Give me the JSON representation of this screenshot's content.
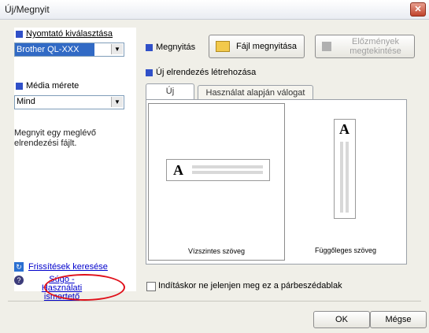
{
  "window": {
    "title": "Új/Megnyit",
    "close_label": "✕"
  },
  "left": {
    "printer_label": "Nyomtató kiválasztása",
    "printer_value": "Brother QL-XXX",
    "media_label": "Média mérete",
    "media_value": "Mind",
    "description": "Megnyit egy meglévő elrendezési fájlt.",
    "updates_link": "Frissítések keresése",
    "help_link": "Súgó - Használati ismertető"
  },
  "top": {
    "open_label": "Megnyitás",
    "open_file_button": "Fájl megnyitása",
    "history_button": "Előzmények megtekintése",
    "new_layout_label": "Új elrendezés létrehozása"
  },
  "tabs": [
    {
      "label": "Új",
      "active": true
    },
    {
      "label": "Használat alapján válogat",
      "active": false
    }
  ],
  "cards": [
    {
      "label": "Vízszintes szöveg",
      "glyph": "A"
    },
    {
      "label": "Függőleges szöveg",
      "glyph": "A"
    }
  ],
  "footer": {
    "startup_checkbox": "Indításkor ne jelenjen meg ez a párbeszédablak",
    "ok": "OK",
    "cancel": "Mégse"
  },
  "colors": {
    "accent_square": "#3050c8",
    "highlight": "#316ac5",
    "annotation_circle": "#e0101a"
  },
  "icons": [
    "close-icon",
    "folder-open-icon",
    "history-icon",
    "update-icon",
    "help-icon",
    "dropdown-arrow-icon"
  ]
}
